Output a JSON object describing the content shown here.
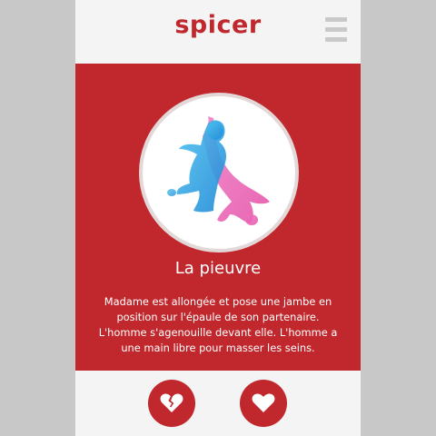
{
  "app": {
    "title": "spicer"
  },
  "header": {
    "menu_icon": "hamburger-menu-icon"
  },
  "card": {
    "image_alt": "illustration-couple-position",
    "title": "La pieuvre",
    "description": "Madame est allongée et pose une jambe en\nposition sur l'épaule de son partenaire.\nL'homme s'agenouille devant elle. L'homme a\nune main libre pour masser les seins."
  },
  "actions": {
    "dislike_icon": "broken-heart-icon",
    "like_icon": "heart-icon"
  },
  "colors": {
    "accent": "#c0282d",
    "background": "#f4f4f4",
    "outer": "#c8c8c8",
    "figure_blue": "#2aa5e0",
    "figure_pink": "#e85cb0"
  }
}
